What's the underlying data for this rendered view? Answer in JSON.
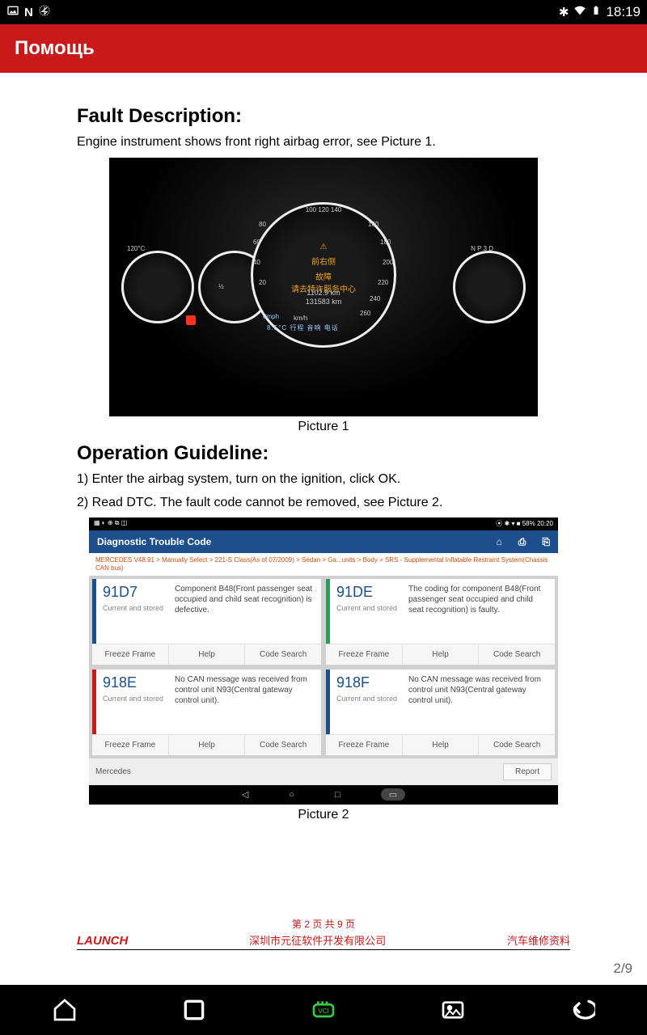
{
  "status_bar": {
    "time": "18:19"
  },
  "app_bar": {
    "title": "Помощь"
  },
  "section1": {
    "heading": "Fault Description:",
    "text": "Engine instrument shows front right airbag error, see Picture 1."
  },
  "dash": {
    "caption": "Picture 1",
    "warn_cn1": "前右侧",
    "warn_cn2": "故障",
    "warn_cn3": "请去特许服务中心",
    "odo1": "1102.9 km",
    "odo2": "131583 km",
    "speed_ticks": "20 40 60 80 100 120 140 160 180 200 220 240 260",
    "temp_label": "120°C",
    "mph": "0mph",
    "kmh": "km/h",
    "row_labels": "8.5°C   行程         音响          电话",
    "gear": "N P 3 D"
  },
  "section2": {
    "heading": "Operation Guideline:",
    "line1": "1) Enter the airbag system, turn on the ignition, click OK.",
    "line2": "2) Read DTC. The fault code cannot be removed, see Picture 2."
  },
  "dtc": {
    "caption": "Picture 2",
    "status_right": "⦿ ✱ ▾ ■ 58% 20:20",
    "header": "Diagnostic Trouble Code",
    "crumb": "MERCEDES V48.91 > Manually Select > 221-S Class(As of 07/2009) > Sedan > Ga...units > Body > SRS - Supplemental Inflatable Restraint System(Chassis CAN bus)",
    "cards": [
      {
        "code": "91D7",
        "status": "Current and stored",
        "desc": "Component B48(Front passenger seat occupied and child seat recognition) is defective.",
        "bar": "bar-blue"
      },
      {
        "code": "91DE",
        "status": "Current and stored",
        "desc": "The coding for component B48(Front passenger seat occupied and child seat recognition) is faulty.",
        "bar": "bar-green"
      },
      {
        "code": "918E",
        "status": "Current and stored",
        "desc": "No CAN message was received from control unit N93(Central gateway control unit).",
        "bar": "bar-red"
      },
      {
        "code": "918F",
        "status": "Current and stored",
        "desc": "No CAN message was received from control unit N93(Central gateway control unit).",
        "bar": "bar-blue"
      }
    ],
    "btn_freeze": "Freeze Frame",
    "btn_help": "Help",
    "btn_search": "Code Search",
    "footer_left": "Mercedes",
    "footer_btn": "Report"
  },
  "doc_footer": {
    "pageline": "第 2 页 共 9 页",
    "brand": "LAUNCH",
    "center": "深圳市元征软件开发有限公司",
    "right": "汽车维修资料"
  },
  "page_counter": "2/9"
}
